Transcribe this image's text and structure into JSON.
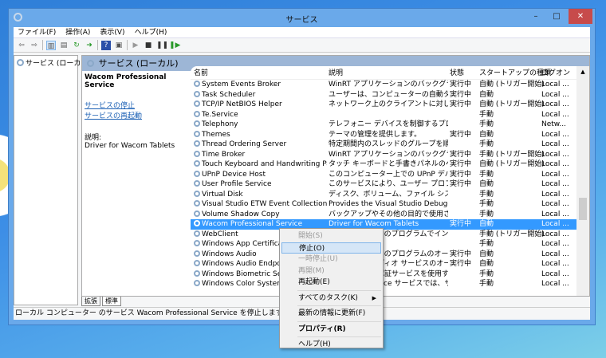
{
  "window": {
    "title": "サービス",
    "minimize": "–",
    "maximize": "□",
    "close": "✕"
  },
  "menubar": [
    "ファイル(F)",
    "操作(A)",
    "表示(V)",
    "ヘルプ(H)"
  ],
  "tree": {
    "item": "サービス (ローカル)"
  },
  "panel": {
    "header": "サービス (ローカル)",
    "service_name": "Wacom Professional Service",
    "stop_link": "サービスの停止",
    "restart_link": "サービスの再起動",
    "desc_label": "説明:",
    "desc": "Driver for Wacom Tablets"
  },
  "columns": {
    "name": "名前",
    "desc": "説明",
    "status": "状態",
    "startup": "スタートアップの種類",
    "logon": "ログオン"
  },
  "rows": [
    {
      "name": "System Events Broker",
      "desc": "WinRT アプリケーションのバックグラウンド処...",
      "status": "実行中",
      "startup": "自動 (トリガー開始)",
      "logon": "Local ..."
    },
    {
      "name": "Task Scheduler",
      "desc": "ユーザーは、コンピューターの自動タスクを構...",
      "status": "実行中",
      "startup": "自動",
      "logon": "Local ..."
    },
    {
      "name": "TCP/IP NetBIOS Helper",
      "desc": "ネットワーク上のクライアントに対して、NetBI...",
      "status": "実行中",
      "startup": "自動 (トリガー開始)",
      "logon": "Local ..."
    },
    {
      "name": "Te.Service",
      "desc": "",
      "status": "",
      "startup": "手動",
      "logon": "Local ..."
    },
    {
      "name": "Telephony",
      "desc": "テレフォニー デバイスを制御するプログラムを...",
      "status": "",
      "startup": "手動",
      "logon": "Netw..."
    },
    {
      "name": "Themes",
      "desc": "テーマの管理を提供します。",
      "status": "実行中",
      "startup": "自動",
      "logon": "Local ..."
    },
    {
      "name": "Thread Ordering Server",
      "desc": "特定期間内のスレッドのグループを順序どお...",
      "status": "",
      "startup": "手動",
      "logon": "Local ..."
    },
    {
      "name": "Time Broker",
      "desc": "WinRT アプリケーションのバックグラウンド処...",
      "status": "実行中",
      "startup": "手動 (トリガー開始)",
      "logon": "Local ..."
    },
    {
      "name": "Touch Keyboard and Handwriting Pan...",
      "desc": "タッチ キーボードと手書きパネルのペンおよび...",
      "status": "実行中",
      "startup": "自動 (トリガー開始)",
      "logon": "Local ..."
    },
    {
      "name": "UPnP Device Host",
      "desc": "このコンピューター上での UPnP デバイスのホ...",
      "status": "実行中",
      "startup": "手動",
      "logon": "Local ..."
    },
    {
      "name": "User Profile Service",
      "desc": "このサービスにより、ユーザー プロファイルのロ...",
      "status": "実行中",
      "startup": "自動",
      "logon": "Local ..."
    },
    {
      "name": "Virtual Disk",
      "desc": "ディスク、ボリューム、ファイル システム、および...",
      "status": "",
      "startup": "手動",
      "logon": "Local ..."
    },
    {
      "name": "Visual Studio ETW Event Collection Se...",
      "desc": "Provides the Visual Studio Debugge...",
      "status": "",
      "startup": "手動",
      "logon": "Local ..."
    },
    {
      "name": "Volume Shadow Copy",
      "desc": "バックアップやその他の目的で使用されるボリ...",
      "status": "",
      "startup": "手動",
      "logon": "Local ..."
    },
    {
      "name": "Wacom Professional Service",
      "desc": "Driver for Wacom Tablets",
      "status": "実行中",
      "startup": "自動",
      "logon": "Local ..."
    },
    {
      "name": "WebClient",
      "desc": "Windows ベースのプログラムでインターネッ...",
      "status": "",
      "startup": "手動 (トリガー開始)",
      "logon": "Local ..."
    },
    {
      "name": "Windows App Certification Kit Fast...",
      "desc": "",
      "status": "",
      "startup": "手動",
      "logon": "Local ..."
    },
    {
      "name": "Windows Audio",
      "desc": "Windows ベースのプログラムのオーディオを...",
      "status": "実行中",
      "startup": "自動",
      "logon": "Local ..."
    },
    {
      "name": "Windows Audio Endpoint Builder",
      "desc": "Windows オーディオ サービスのオーディオ デバ...",
      "status": "実行中",
      "startup": "自動",
      "logon": "Local ..."
    },
    {
      "name": "Windows Biometric Service",
      "desc": "Windows 生体認証サービスを使用すると、...",
      "status": "",
      "startup": "手動",
      "logon": "Local ..."
    },
    {
      "name": "Windows Color System",
      "desc": "WcsPlugInService サービスでは、サード ...",
      "status": "",
      "startup": "手動",
      "logon": "Local ..."
    }
  ],
  "tabs": [
    "拡張",
    "標準"
  ],
  "statusbar": "ローカル コンピューター のサービス Wacom Professional Service を停止します。",
  "context_menu": {
    "start": "開始(S)",
    "stop": "停止(O)",
    "pause": "一時停止(U)",
    "resume": "再開(M)",
    "restart": "再起動(E)",
    "all_tasks": "すべてのタスク(K)",
    "refresh": "最新の情報に更新(F)",
    "properties": "プロパティ(R)",
    "help": "ヘルプ(H)"
  }
}
